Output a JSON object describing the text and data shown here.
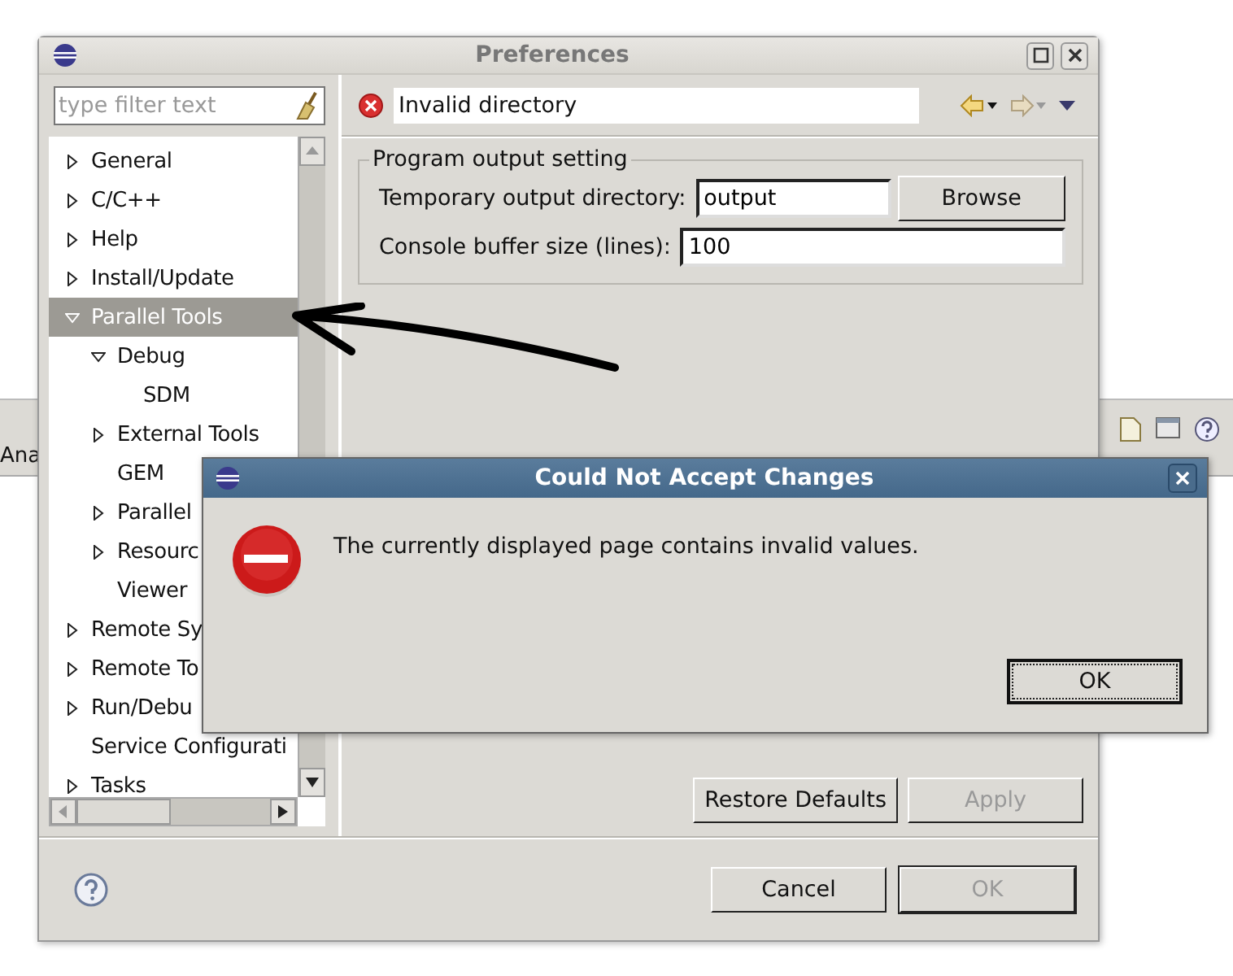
{
  "background_window": {
    "tab_text": "Ana"
  },
  "window": {
    "title": "Preferences",
    "filter": {
      "placeholder": "type filter text"
    },
    "tree": [
      {
        "label": "General",
        "expanded": false,
        "selected": false
      },
      {
        "label": "C/C++",
        "expanded": false,
        "selected": false
      },
      {
        "label": "Help",
        "expanded": false,
        "selected": false
      },
      {
        "label": "Install/Update",
        "expanded": false,
        "selected": false
      },
      {
        "label": "Parallel Tools",
        "expanded": true,
        "selected": true,
        "children": [
          {
            "label": "Debug",
            "expanded": true,
            "selected": false,
            "children": [
              {
                "label": "SDM",
                "selected": false
              }
            ]
          },
          {
            "label": "External Tools",
            "expanded": false,
            "selected": false
          },
          {
            "label": "GEM",
            "selected": false
          },
          {
            "label": "Parallel",
            "expanded": false,
            "selected": false
          },
          {
            "label": "Resourc",
            "expanded": false,
            "selected": false
          },
          {
            "label": "Viewer",
            "selected": false
          }
        ]
      },
      {
        "label": "Remote Sy",
        "expanded": false,
        "selected": false
      },
      {
        "label": "Remote To",
        "expanded": false,
        "selected": false
      },
      {
        "label": "Run/Debu",
        "expanded": false,
        "selected": false
      },
      {
        "label": "Service Configurati",
        "selected": false
      },
      {
        "label": "Tasks",
        "expanded": false,
        "selected": false
      }
    ],
    "page": {
      "message": "Invalid directory",
      "group": {
        "title": "Program output setting",
        "fields": [
          {
            "label": "Temporary output directory:",
            "value": "output",
            "button": "Browse"
          },
          {
            "label": "Console buffer size (lines):",
            "value": "100"
          }
        ]
      },
      "buttons": [
        {
          "label": "Restore Defaults",
          "disabled": false
        },
        {
          "label": "Apply",
          "disabled": true
        }
      ]
    },
    "buttons": [
      {
        "label": "Cancel",
        "disabled": false
      },
      {
        "label": "OK",
        "disabled": true
      }
    ]
  },
  "dialog": {
    "title": "Could Not Accept Changes",
    "message": "The currently displayed page contains invalid values.",
    "buttons": [
      {
        "label": "OK",
        "focused": true
      }
    ]
  }
}
